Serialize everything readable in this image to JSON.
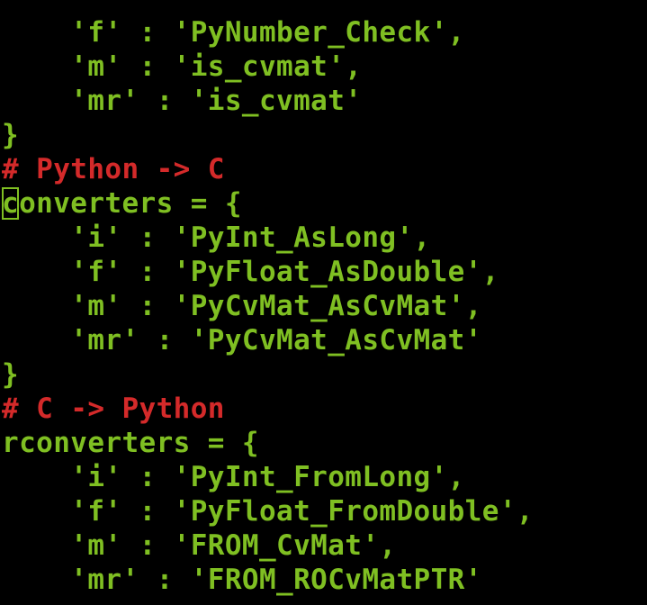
{
  "colors": {
    "background": "#000000",
    "code": "#7fbf22",
    "comment": "#d42a2a"
  },
  "lines": [
    {
      "text": "    'f' : 'PyNumber_Check',",
      "kind": "code"
    },
    {
      "text": "    'm' : 'is_cvmat',",
      "kind": "code"
    },
    {
      "text": "    'mr' : 'is_cvmat'",
      "kind": "code"
    },
    {
      "text": "}",
      "kind": "code"
    },
    {
      "text": "# Python -> C",
      "kind": "comment"
    },
    {
      "text": "converters = {",
      "kind": "code",
      "cursor_char": "c",
      "rest": "onverters = {"
    },
    {
      "text": "    'i' : 'PyInt_AsLong',",
      "kind": "code"
    },
    {
      "text": "    'f' : 'PyFloat_AsDouble',",
      "kind": "code"
    },
    {
      "text": "    'm' : 'PyCvMat_AsCvMat',",
      "kind": "code"
    },
    {
      "text": "    'mr' : 'PyCvMat_AsCvMat'",
      "kind": "code"
    },
    {
      "text": "}",
      "kind": "code"
    },
    {
      "text": "# C -> Python",
      "kind": "comment"
    },
    {
      "text": "rconverters = {",
      "kind": "code"
    },
    {
      "text": "    'i' : 'PyInt_FromLong',",
      "kind": "code"
    },
    {
      "text": "    'f' : 'PyFloat_FromDouble',",
      "kind": "code"
    },
    {
      "text": "    'm' : 'FROM_CvMat',",
      "kind": "code"
    },
    {
      "text": "    'mr' : 'FROM_ROCvMatPTR'",
      "kind": "code"
    }
  ]
}
